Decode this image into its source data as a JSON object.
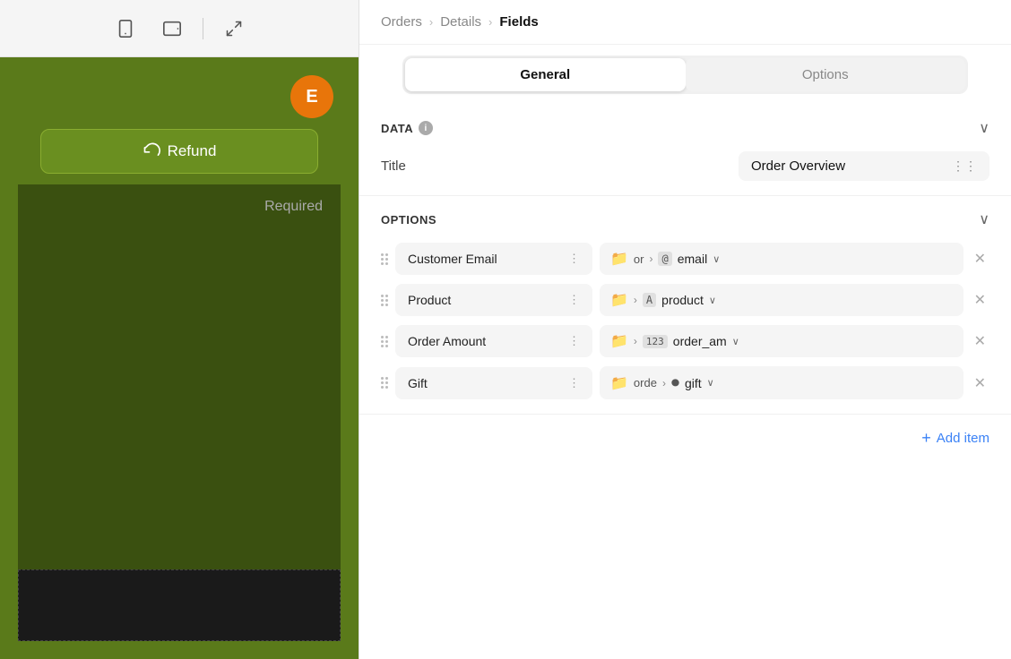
{
  "toolbar": {
    "phone_icon": "📱",
    "tablet_icon": "⬜",
    "expand_icon": "↗"
  },
  "preview": {
    "avatar_label": "E",
    "refund_button_label": "Refund",
    "required_label": "Required"
  },
  "breadcrumb": {
    "items": [
      "Orders",
      "Details",
      "Fields"
    ]
  },
  "tabs": {
    "general_label": "General",
    "options_label": "Options"
  },
  "data_section": {
    "title": "DATA",
    "title_field_label": "Title",
    "title_field_value": "Order Overview"
  },
  "options_section": {
    "title": "OPTIONS",
    "items": [
      {
        "label": "Customer Email",
        "folder": "📁",
        "prefix": "or",
        "separator": ">",
        "type_icon": "@",
        "value": "email"
      },
      {
        "label": "Product",
        "folder": "📁",
        "prefix": "",
        "separator": ">",
        "type_icon": "A",
        "value": "product"
      },
      {
        "label": "Order Amount",
        "folder": "📁",
        "prefix": "",
        "separator": ">",
        "type_icon": "123",
        "value": "order_am"
      },
      {
        "label": "Gift",
        "folder": "📁",
        "prefix": "orde",
        "separator": ">",
        "type_icon": "⏺",
        "value": "gift"
      }
    ]
  },
  "add_item": {
    "label": "Add item"
  }
}
